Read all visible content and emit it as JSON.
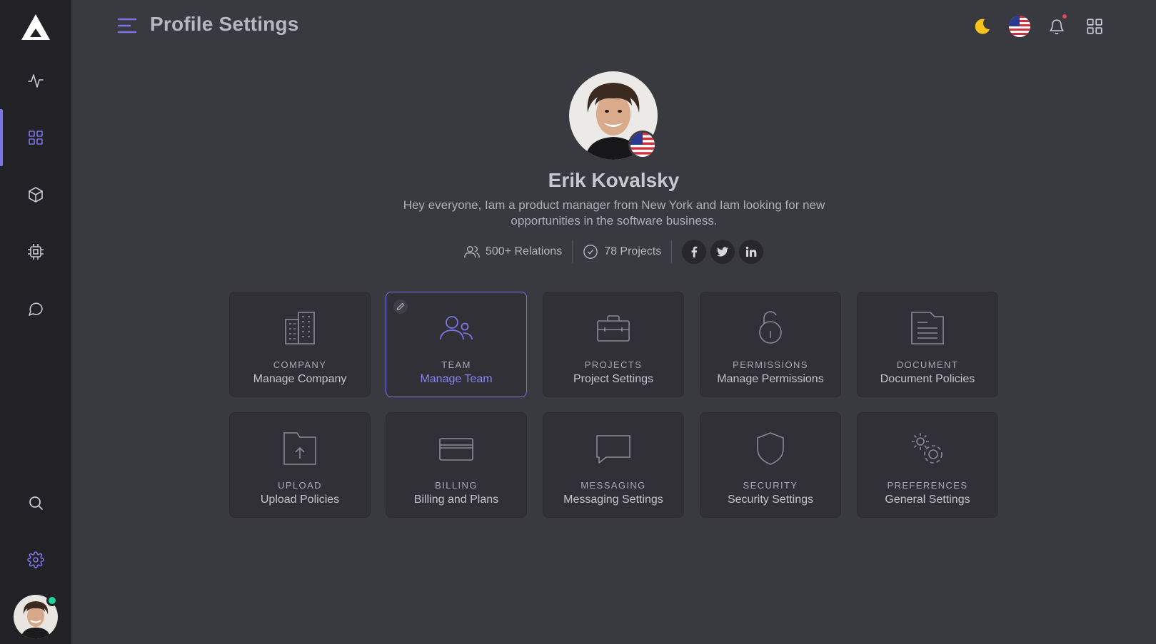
{
  "header": {
    "title": "Profile Settings"
  },
  "profile": {
    "name": "Erik Kovalsky",
    "bio": "Hey everyone, Iam a product manager from New York and Iam looking for new opportunities in the software business.",
    "relations": "500+ Relations",
    "projects": "78 Projects",
    "social": [
      {
        "name": "facebook",
        "glyph": "f"
      },
      {
        "name": "twitter",
        "glyph": "t"
      },
      {
        "name": "linkedin",
        "glyph": "in"
      }
    ]
  },
  "tiles": [
    {
      "key": "company",
      "label": "COMPANY",
      "sub": "Manage Company",
      "icon": "building-icon"
    },
    {
      "key": "team",
      "label": "TEAM",
      "sub": "Manage Team",
      "icon": "users-icon",
      "active": true
    },
    {
      "key": "projects",
      "label": "PROJECTS",
      "sub": "Project Settings",
      "icon": "briefcase-icon"
    },
    {
      "key": "permissions",
      "label": "PERMISSIONS",
      "sub": "Manage Permissions",
      "icon": "unlock-icon"
    },
    {
      "key": "document",
      "label": "DOCUMENT",
      "sub": "Document Policies",
      "icon": "document-icon"
    },
    {
      "key": "upload",
      "label": "UPLOAD",
      "sub": "Upload Policies",
      "icon": "upload-folder-icon"
    },
    {
      "key": "billing",
      "label": "BILLING",
      "sub": "Billing and Plans",
      "icon": "credit-card-icon"
    },
    {
      "key": "messaging",
      "label": "MESSAGING",
      "sub": "Messaging Settings",
      "icon": "message-icon"
    },
    {
      "key": "security",
      "label": "SECURITY",
      "sub": "Security Settings",
      "icon": "shield-icon"
    },
    {
      "key": "preferences",
      "label": "PREFERENCES",
      "sub": "General Settings",
      "icon": "gears-icon"
    }
  ],
  "colors": {
    "accent": "#7b74e8",
    "background": "#393940",
    "sidebar": "#222226",
    "tile": "#303036",
    "online": "#19d49b",
    "moon": "#f8c21c",
    "notification": "#e5455b"
  }
}
